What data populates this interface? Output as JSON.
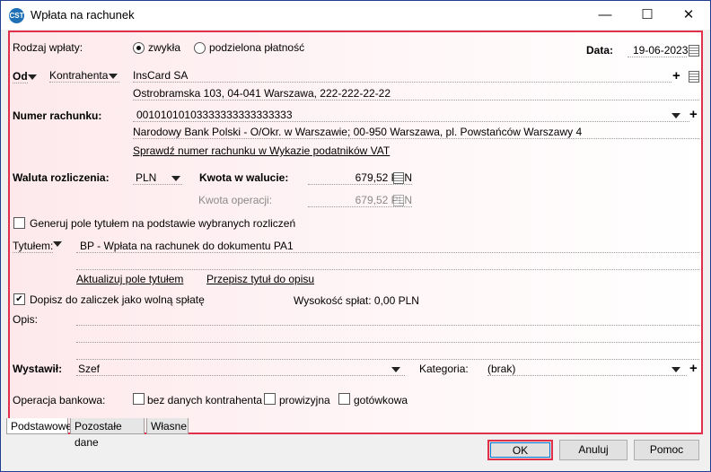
{
  "window": {
    "title": "Wpłata na rachunek",
    "icon": "cst-logo-icon"
  },
  "form": {
    "rodzaj_label": "Rodzaj wpłaty:",
    "rodzaj_options": [
      "zwykła",
      "podzielona płatność"
    ],
    "rodzaj_selected": "zwykła",
    "data_label": "Data:",
    "data_value": "19-06-2023",
    "od_label": "Od",
    "od_type": "Kontrahenta",
    "contractor_name": "InsCard SA",
    "contractor_address": "Ostrobramska 103, 04-041 Warszawa, 222-222-22-22",
    "numer_label": "Numer rachunku:",
    "numer_value": "00101010103333333333333333",
    "bank_info": "Narodowy Bank Polski  - O/Okr. w Warszawie; 00-950 Warszawa, pl. Powstańców Warszawy 4",
    "check_vat_link": "Sprawdź numer rachunku w Wykazie podatników VAT",
    "waluta_label": "Waluta rozliczenia:",
    "waluta_value": "PLN",
    "kwota_waluta_label": "Kwota w walucie:",
    "kwota_waluta_value": "679,52 PLN",
    "kwota_operacji_label": "Kwota operacji:",
    "kwota_operacji_value": "679,52 PLN",
    "generuj_label": "Generuj pole tytułem na podstawie wybranych rozliczeń",
    "generuj_checked": false,
    "tytulem_label": "Tytułem:",
    "tytulem_value": "BP - Wpłata na rachunek do dokumentu PA1",
    "aktualizuj_link": "Aktualizuj pole tytułem",
    "przepisz_link": "Przepisz tytuł do opisu",
    "dopisz_label": "Dopisz do zaliczek jako wolną spłatę",
    "dopisz_checked": true,
    "wysokosc_label": "Wysokość spłat: 0,00 PLN",
    "opis_label": "Opis:",
    "wystawil_label": "Wystawił:",
    "wystawil_value": "Szef",
    "kategoria_label": "Kategoria:",
    "kategoria_value": "(brak)",
    "operacja_label": "Operacja bankowa:",
    "operacja_options": [
      "bez danych kontrahenta",
      "prowizyjna",
      "gotówkowa"
    ]
  },
  "tabs": [
    "Podstawowe",
    "Pozostałe dane",
    "Własne"
  ],
  "active_tab": "Podstawowe",
  "buttons": {
    "ok": "OK",
    "cancel": "Anuluj",
    "help": "Pomoc"
  },
  "colors": {
    "accent_border": "#e0304a",
    "titlebar": "#ffffff",
    "dialog_bg": "#f0f0f0"
  }
}
